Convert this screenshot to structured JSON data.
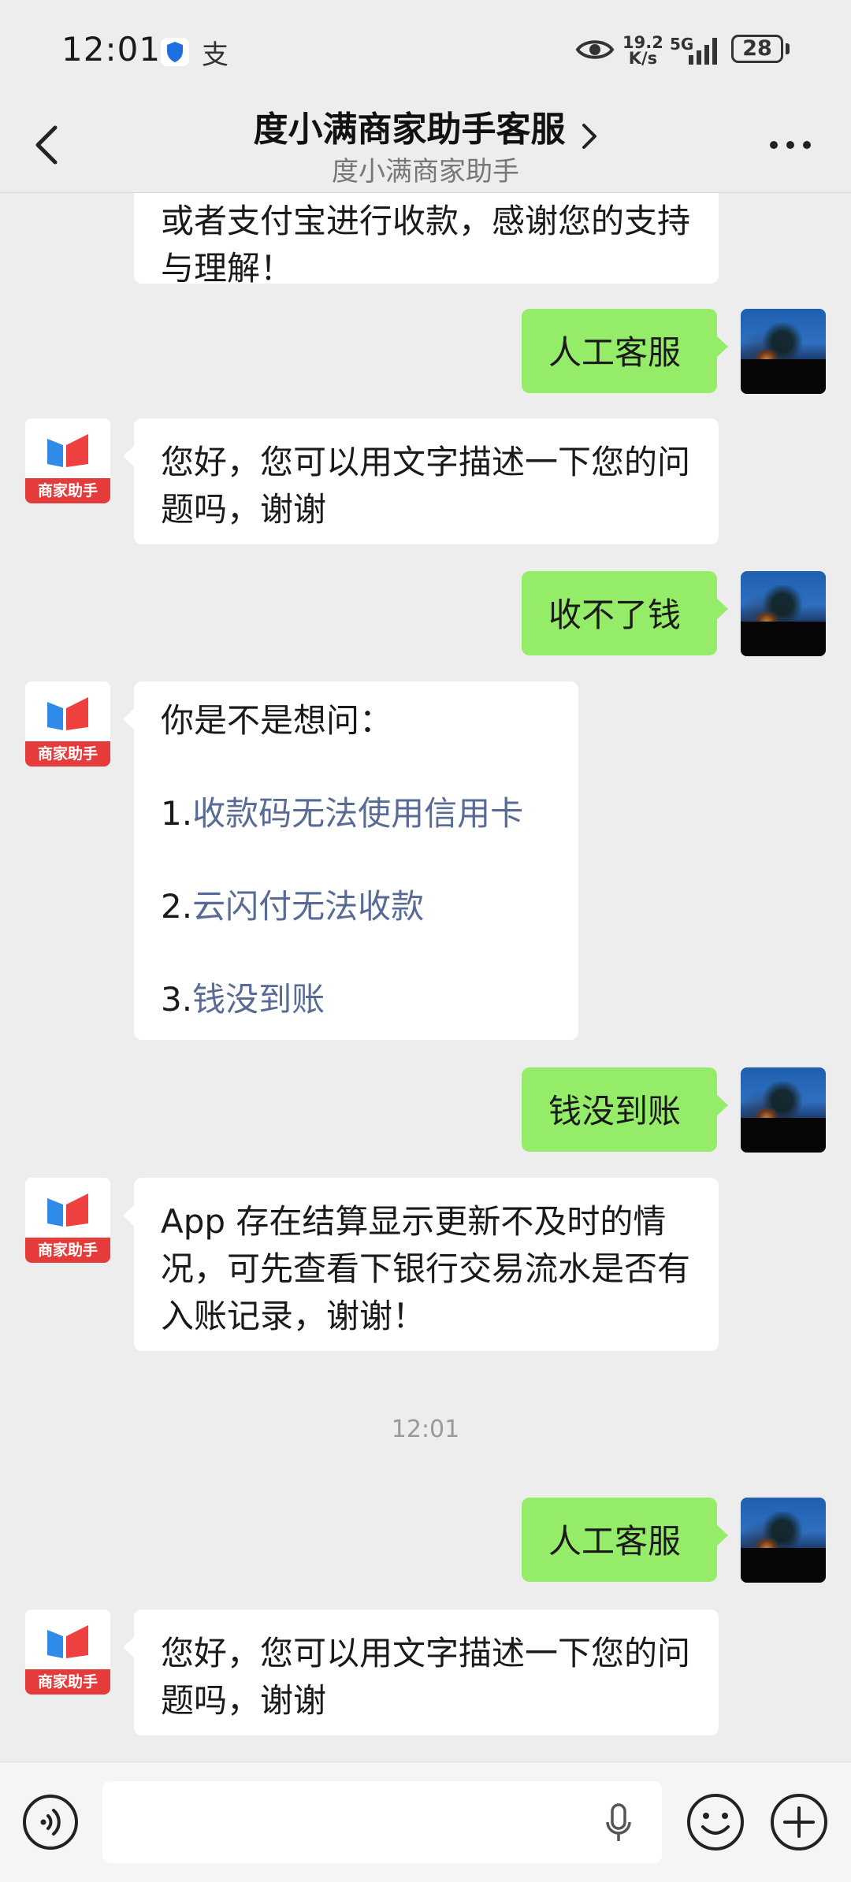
{
  "status_bar": {
    "time": "12:01",
    "pay_glyph": "支",
    "net_speed_top": "19.2",
    "net_speed_bottom": "K/s",
    "network": "5G",
    "battery": "28"
  },
  "header": {
    "title": "度小满商家助手客服",
    "subtitle": "度小满商家助手"
  },
  "bot": {
    "avatar_label": "商家助手"
  },
  "messages": {
    "m0": "或者支付宝进行收款，感谢您的支持与理解！",
    "m1": "人工客服",
    "m2": "您好，您可以用文字描述一下您的问题吗，谢谢",
    "m3": "收不了钱",
    "m4": {
      "intro": "你是不是想问：",
      "options": [
        {
          "num": "1.",
          "text": "收款码无法使用信用卡"
        },
        {
          "num": "2.",
          "text": "云闪付无法收款"
        },
        {
          "num": "3.",
          "text": "钱没到账"
        }
      ]
    },
    "m5": "钱没到账",
    "m6": "App 存在结算显示更新不及时的情况，可先查看下银行交易流水是否有入账记录，谢谢！",
    "time_divider": "12:01",
    "m7": "人工客服",
    "m8": "您好，您可以用文字描述一下您的问题吗，谢谢"
  },
  "input": {
    "placeholder": ""
  },
  "icons": {
    "back": "back-arrow-icon",
    "more": "more-dots-icon",
    "voice": "voice-icon",
    "mic": "microphone-icon",
    "emoji": "emoji-icon",
    "plus": "plus-icon"
  },
  "colors": {
    "outgoing_bubble": "#95ec69",
    "incoming_bubble": "#ffffff",
    "link": "#576b95",
    "background": "#ededed"
  }
}
